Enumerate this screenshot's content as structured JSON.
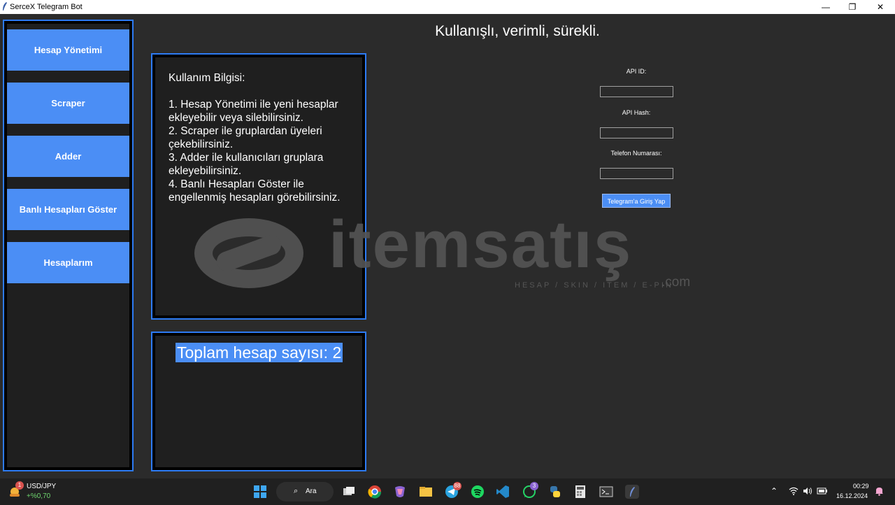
{
  "window": {
    "title": "SerceX Telegram Bot",
    "controls": {
      "minimize": "—",
      "maximize": "❐",
      "close": "✕"
    }
  },
  "sidebar": {
    "items": [
      {
        "label": "Hesap Yönetimi"
      },
      {
        "label": "Scraper"
      },
      {
        "label": "Adder"
      },
      {
        "label": "Banlı Hesapları Göster"
      },
      {
        "label": "Hesaplarım"
      }
    ]
  },
  "main": {
    "headline": "Kullanışlı, verimli, sürekli.",
    "info": {
      "title": "Kullanım Bilgisi:",
      "lines": [
        "1. Hesap Yönetimi ile yeni hesaplar ekleyebilir veya silebilirsiniz.",
        "2. Scraper ile gruplardan üyeleri çekebilirsiniz.",
        "3. Adder ile kullanıcıları gruplara ekleyebilirsiniz.",
        "4. Banlı Hesapları Göster ile engellenmiş hesapları görebilirsiniz."
      ]
    },
    "account_count": "Toplam hesap sayısı: 2"
  },
  "watermark": {
    "brand": "itemsatış",
    "tagline": "HESAP / SKIN / ITEM / E-PIN",
    "suffix": ".com"
  },
  "login": {
    "api_id_label": "API ID:",
    "api_id_value": "",
    "api_hash_label": "API Hash:",
    "api_hash_value": "",
    "phone_label": "Telefon Numarası:",
    "phone_value": "",
    "submit_label": "Telegram'a Giriş Yap"
  },
  "taskbar": {
    "ticker": {
      "name": "USD/JPY",
      "change": "+%0,70",
      "badge": "1"
    },
    "search_label": "Ara",
    "telegram_badge": "88",
    "whatsapp_badge": "3",
    "clock": {
      "time": "00:29",
      "date": "16.12.2024"
    }
  },
  "colors": {
    "accent": "#4b8ef5",
    "border": "#2d7bf4",
    "background": "#2b2b2b",
    "panel": "#1f1f1f"
  }
}
